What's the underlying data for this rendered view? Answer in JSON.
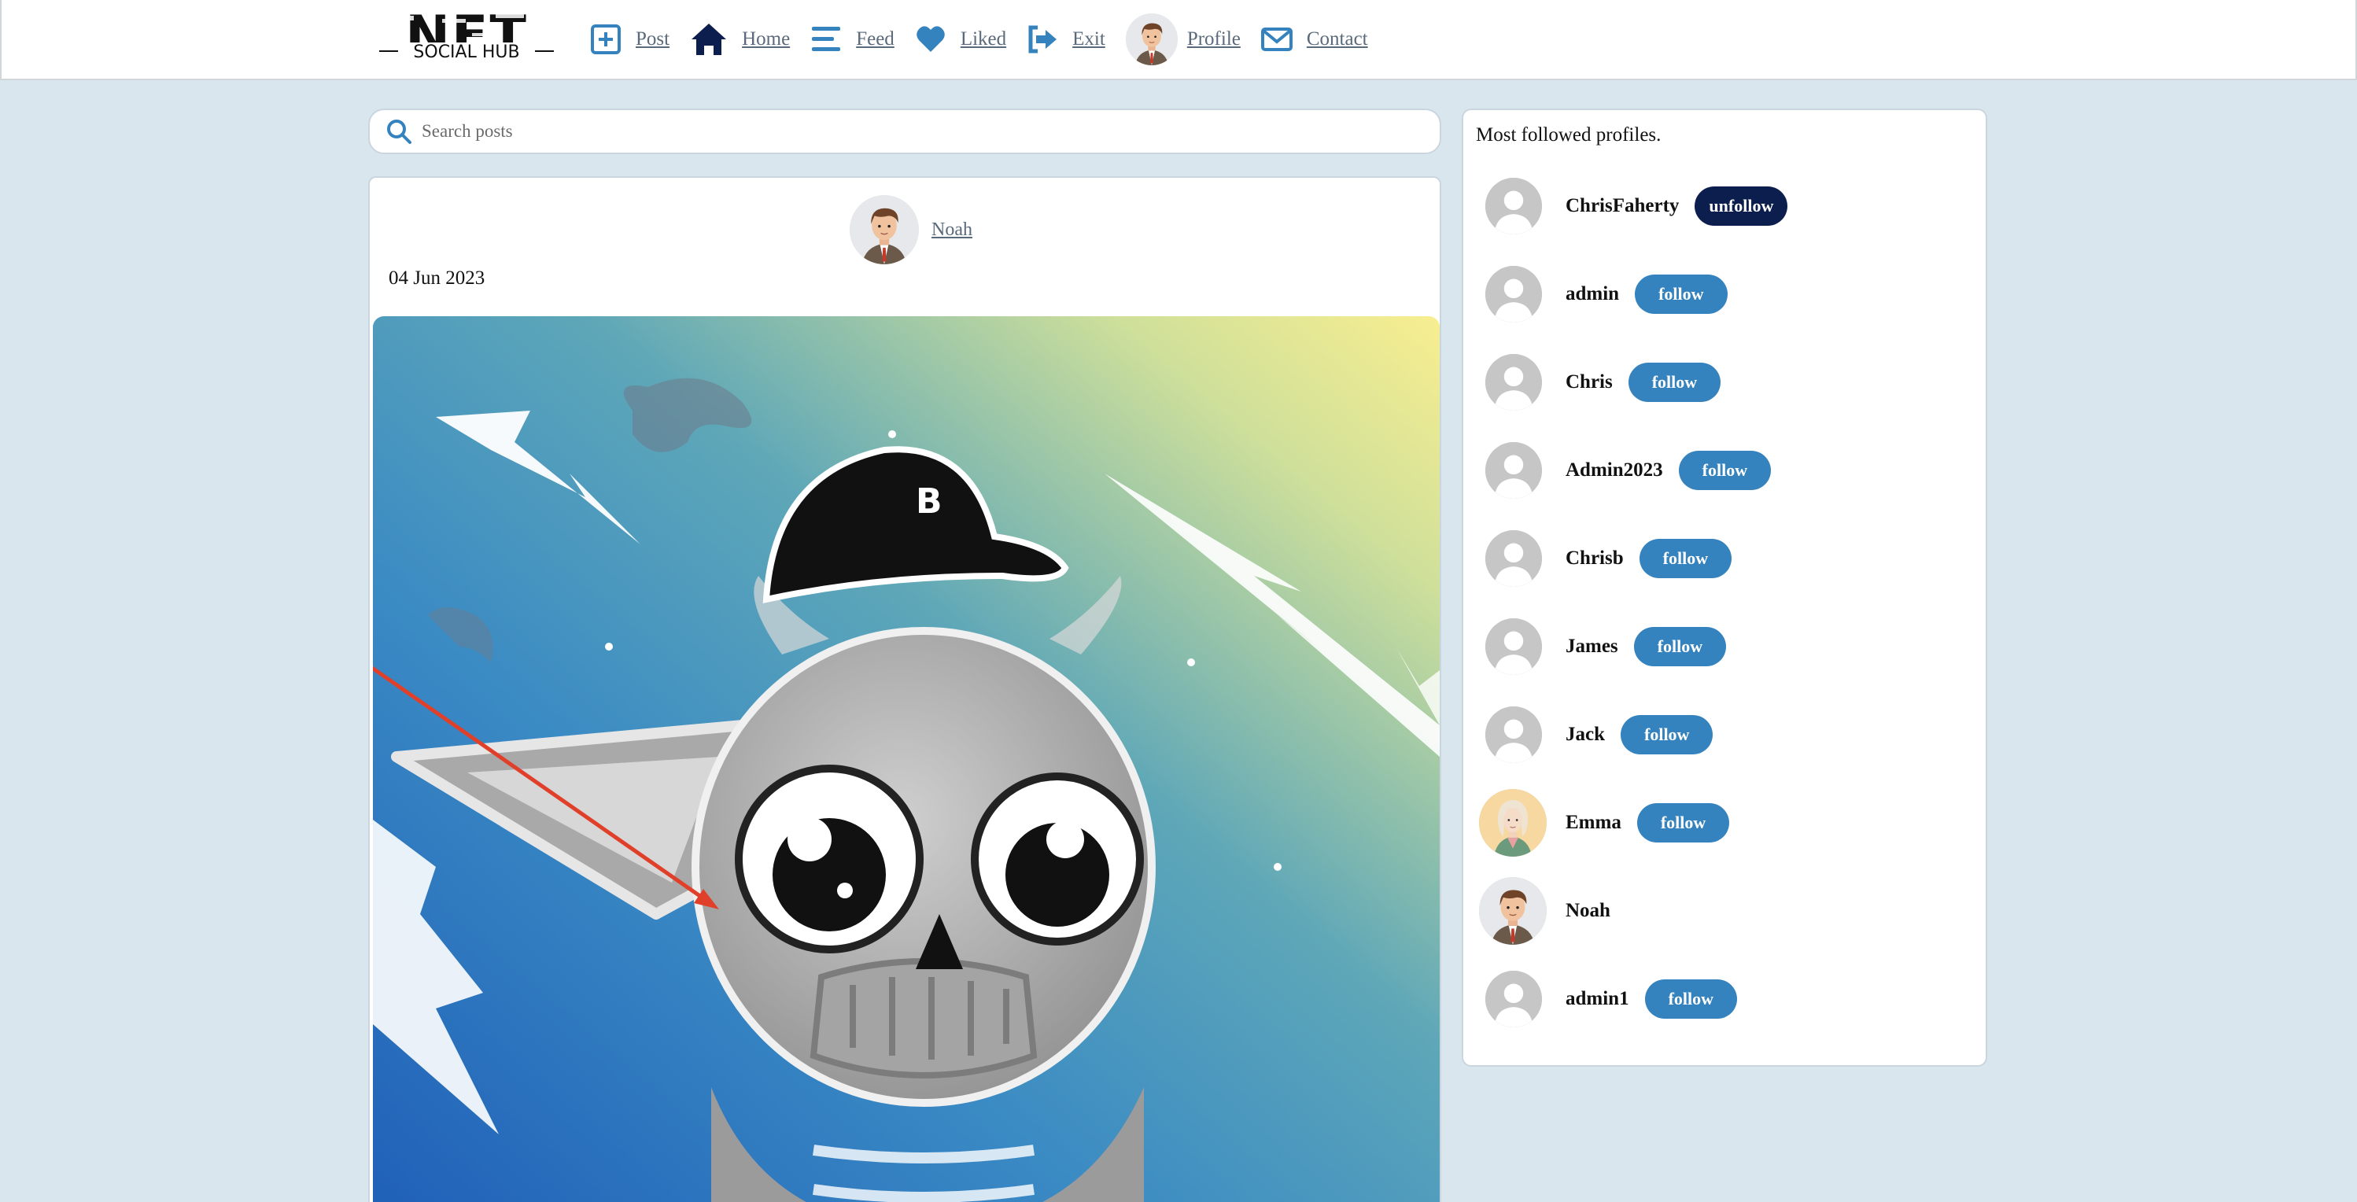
{
  "nav": {
    "logo_text": "NFT",
    "logo_subtext": "SOCIAL HUB",
    "items": [
      {
        "label": "Post",
        "icon": "plus-square-icon"
      },
      {
        "label": "Home",
        "icon": "home-icon"
      },
      {
        "label": "Feed",
        "icon": "feed-icon"
      },
      {
        "label": "Liked",
        "icon": "heart-icon"
      },
      {
        "label": "Exit",
        "icon": "exit-icon"
      },
      {
        "label": "Profile",
        "icon": "avatar"
      },
      {
        "label": "Contact",
        "icon": "envelope-icon"
      }
    ]
  },
  "search": {
    "placeholder": "Search posts"
  },
  "post": {
    "author": "Noah",
    "date": "04 Jun 2023"
  },
  "sidebar": {
    "title": "Most followed profiles.",
    "profiles": [
      {
        "name": "ChrisFaherty",
        "action": "unfollow"
      },
      {
        "name": "admin",
        "action": "follow"
      },
      {
        "name": "Chris",
        "action": "follow"
      },
      {
        "name": "Admin2023",
        "action": "follow"
      },
      {
        "name": "Chrisb",
        "action": "follow"
      },
      {
        "name": "James",
        "action": "follow"
      },
      {
        "name": "Jack",
        "action": "follow"
      },
      {
        "name": "Emma",
        "action": "follow"
      },
      {
        "name": "Noah",
        "action": ""
      },
      {
        "name": "admin1",
        "action": "follow"
      }
    ]
  },
  "colors": {
    "accent": "#3583be",
    "unfollow": "#0c1e4d",
    "background": "#d9e6ee",
    "annotation_arrow": "#e0402a"
  }
}
